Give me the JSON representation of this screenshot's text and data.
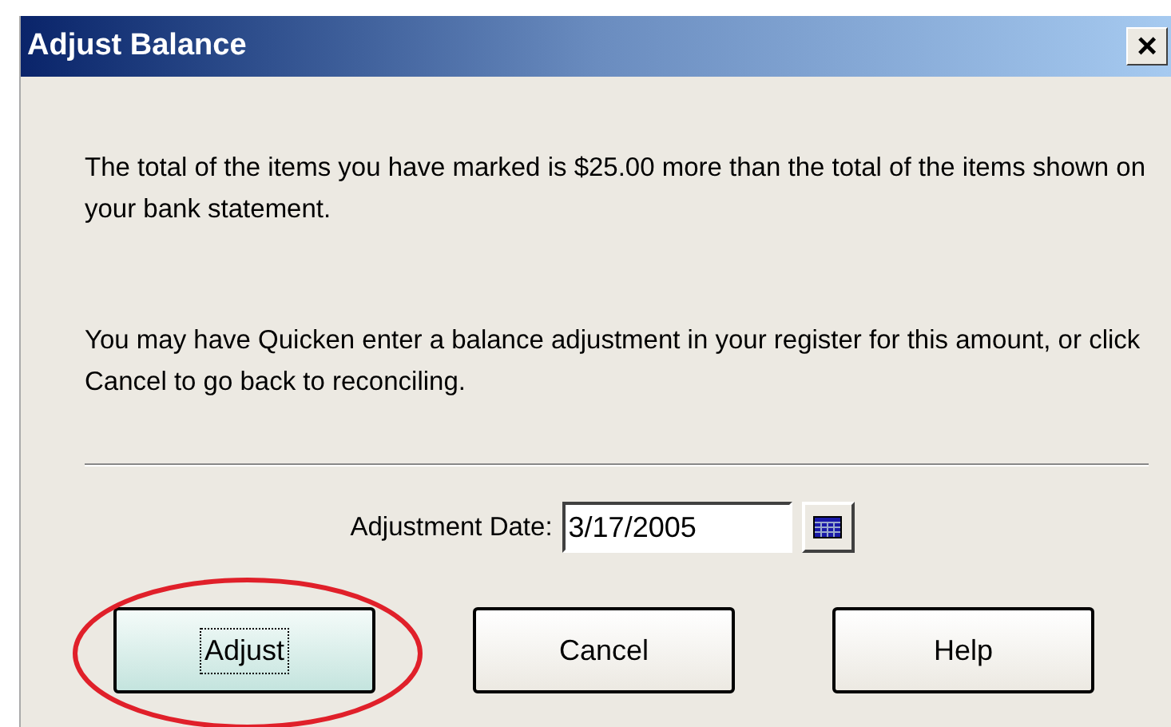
{
  "window": {
    "title": "Adjust Balance",
    "close": "×"
  },
  "message": [
    "The total of the items you have marked is $25.00 more than the total of the items shown on your bank statement.",
    "You may have Quicken enter a balance adjustment in your register for this amount, or click Cancel to go back to reconciling."
  ],
  "date_field": {
    "label": "Adjustment Date:",
    "value": "3/17/2005"
  },
  "buttons": [
    {
      "label": "Adjust",
      "focused": true,
      "highlighted": true
    },
    {
      "label": "Cancel",
      "focused": false,
      "highlighted": false
    },
    {
      "label": "Help",
      "focused": false,
      "highlighted": false
    }
  ]
}
